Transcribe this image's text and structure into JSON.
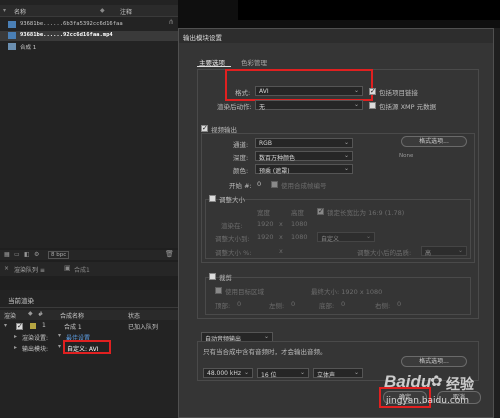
{
  "project": {
    "col_name": "名称",
    "col_comment": "注释",
    "files": [
      "93681be......6b3fa5392cc6d16faa",
      "93681be......92cc6d16faa.mp4",
      "合成 1"
    ],
    "bpc": "8 bpc"
  },
  "render_queue": {
    "tab_label": "渲染队列 ≡",
    "tab2_label": "合成1",
    "current_render": "当前渲染",
    "headers": {
      "render": "渲染",
      "label": "#",
      "comp_name": "合成名称",
      "status": "状态"
    },
    "item": {
      "index": "1",
      "name": "合成 1",
      "status": "已加入队列"
    },
    "render_settings_label": "渲染设置:",
    "render_settings_value": "最佳设置",
    "output_module_label": "输出模块:",
    "output_module_value": "自定义: AVI"
  },
  "dialog": {
    "title": "输出模块设置",
    "tab_main": "主要选项",
    "tab_color": "色彩管理",
    "format_label": "格式:",
    "format_value": "AVI",
    "include_link": "包括项目链接",
    "post_render_label": "渲染后动作:",
    "post_render_value": "无",
    "include_xmp": "包括源 XMP 元数据",
    "video_output": "视频输出",
    "channels_label": "通道:",
    "channels_value": "RGB",
    "format_options_btn": "格式选项...",
    "depth_label": "深度:",
    "depth_value": "数百万种颜色",
    "codec_none": "None",
    "color_label": "颜色:",
    "color_value": "预乘 (遮罩)",
    "start_label": "开始 #:",
    "start_value": "0",
    "use_comp_frame": "使用合成帧编号",
    "resize": "调整大小",
    "width_label": "宽度",
    "height_label": "高度",
    "lock_ratio": "锁定长宽比为 16:9 (1.78)",
    "render_at_label": "渲染在:",
    "render_w": "1920",
    "render_h": "1080",
    "resize_to_label": "调整大小到:",
    "resize_w": "1920",
    "resize_h": "1080",
    "custom": "自定义",
    "resize_pct_label": "调整大小 %:",
    "resize_quality_label": "调整大小后的品质:",
    "resize_quality_value": "高",
    "crop": "裁剪",
    "use_roi": "使用目标区域",
    "final_size": "最终大小: 1920 x 1080",
    "top_label": "顶部:",
    "left_label": "左侧:",
    "bottom_label": "底部:",
    "right_label": "右侧:",
    "zero": "0",
    "x_sep": "x",
    "audio_auto": "自动音频输出",
    "audio_hint": "只有当合成中含有音频时，才会输出音频。",
    "sample_rate": "48.000 kHz",
    "bit_depth": "16 位",
    "stereo": "立体声",
    "format_options_btn2": "格式选项...",
    "ok_btn": "确定",
    "cancel_btn": "取消"
  },
  "watermark": {
    "brand": "Baidu",
    "brand_cn": "经验",
    "url": "jingyan.baidu.com"
  },
  "colors": {
    "highlight_red": "#e02020",
    "link_blue": "#5fa0e6"
  }
}
